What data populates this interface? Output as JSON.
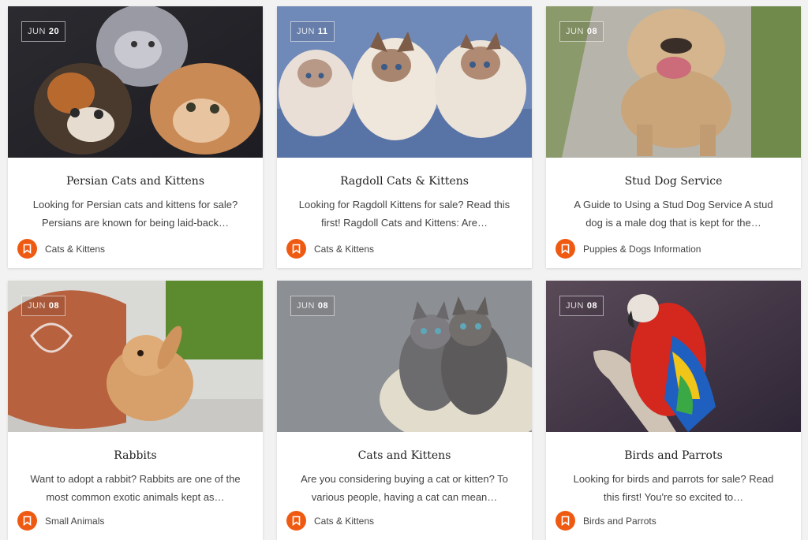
{
  "posts": [
    {
      "month": "JUN",
      "day": "20",
      "title": "Persian Cats and Kittens",
      "excerpt_line1": "Looking for Persian cats and kittens for sale?",
      "excerpt_line2": "Persians are known for being laid-back…",
      "category": "Cats & Kittens",
      "image_icon": "persian-kittens-photo"
    },
    {
      "month": "JUN",
      "day": "11",
      "title": "Ragdoll Cats & Kittens",
      "excerpt_line1": "Looking for Ragdoll Kittens for sale? Read this",
      "excerpt_line2": "first! Ragdoll Cats and Kittens: Are…",
      "category": "Cats & Kittens",
      "image_icon": "ragdoll-kittens-photo"
    },
    {
      "month": "JUN",
      "day": "08",
      "title": "Stud Dog Service",
      "excerpt_line1": "A Guide to Using a Stud Dog Service A stud",
      "excerpt_line2": "dog is a male dog that is kept for the…",
      "category": "Puppies & Dogs Information",
      "image_icon": "bulldog-photo"
    },
    {
      "month": "JUN",
      "day": "08",
      "title": "Rabbits",
      "excerpt_line1": "Want to adopt a rabbit? Rabbits are one of the",
      "excerpt_line2": "most common exotic animals kept as…",
      "category": "Small Animals",
      "image_icon": "rabbit-photo"
    },
    {
      "month": "JUN",
      "day": "08",
      "title": "Cats and Kittens",
      "excerpt_line1": "Are you considering buying a cat or kitten? To",
      "excerpt_line2": "various people, having a cat can mean…",
      "category": "Cats & Kittens",
      "image_icon": "tabby-kittens-photo"
    },
    {
      "month": "JUN",
      "day": "08",
      "title": "Birds and Parrots",
      "excerpt_line1": "Looking for birds and parrots for sale? Read",
      "excerpt_line2": "this first! You're so excited to…",
      "category": "Birds and Parrots",
      "image_icon": "macaw-parrot-photo"
    }
  ],
  "category_icon": "bookmark-icon",
  "colors": {
    "accent": "#ef5a12",
    "title": "#222222",
    "text": "#444444",
    "background": "#f2f2f2"
  }
}
